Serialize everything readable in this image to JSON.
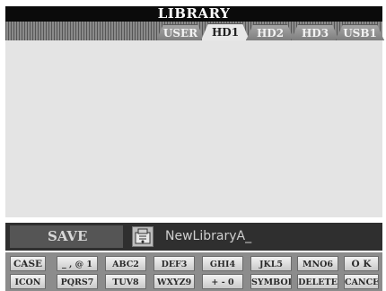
{
  "title": "LIBRARY",
  "tabs": [
    "USER",
    "HD1",
    "HD2",
    "HD3",
    "USB1"
  ],
  "active_tab": "HD1",
  "namebar": {
    "save_label": "SAVE",
    "file_icon": "library-file-icon",
    "name_value": "NewLibraryA_"
  },
  "keyboard": {
    "row1": [
      "CASE",
      "_ , @ 1",
      "ABC2",
      "DEF3",
      "GHI4",
      "JKL5",
      "MNO6",
      "O K"
    ],
    "row2": [
      "ICON",
      "PQRS7",
      "TUV8",
      "WXYZ9",
      "+ - 0",
      "SYMBOL",
      "DELETE",
      "CANCEL"
    ]
  }
}
